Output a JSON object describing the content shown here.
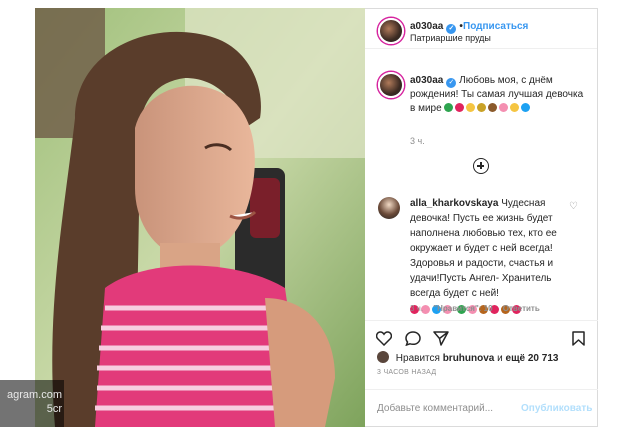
{
  "watermark": {
    "line1": "agram.com",
    "line2": "5cr"
  },
  "header": {
    "username": "a030aa",
    "follow_label": "Подписаться",
    "dot": "•",
    "location": "Патриаршие пруды",
    "verified_icon": "✓"
  },
  "caption": {
    "username": "a030aa",
    "text": "Любовь моя, с днём рождения! Ты самая лучшая девочка в мире",
    "emoji_colors": [
      "#2ea44f",
      "#e0245e",
      "#f5c542",
      "#c9a227",
      "#8b5a2b",
      "#f48fb1",
      "#f5c542",
      "#1da1f2"
    ],
    "time": "3 ч."
  },
  "load_more_icon": "plus-circle-icon",
  "comment": {
    "username": "alla_kharkovskaya",
    "text_part1": "Чудесная девочка! Пусть ее жизнь будет наполнена любовью тех, кто ее окружает и будет с ней всегда! Здоровья и радости, счастья и удачи!Пусть Ангел- Хранитель всегда будет с ней!",
    "time": "3 ч.",
    "likes": "\"Нравится\": 10",
    "reply": "Ответить",
    "heart_icon": "♡"
  },
  "likes": {
    "prefix": "Нравится",
    "user": "bruhunova",
    "and": "и",
    "count": "ещё 20 713"
  },
  "posted_ago": "3 ЧАСОВ НАЗАД",
  "add_comment": {
    "placeholder": "Добавьте комментарий...",
    "publish": "Опубликовать"
  }
}
